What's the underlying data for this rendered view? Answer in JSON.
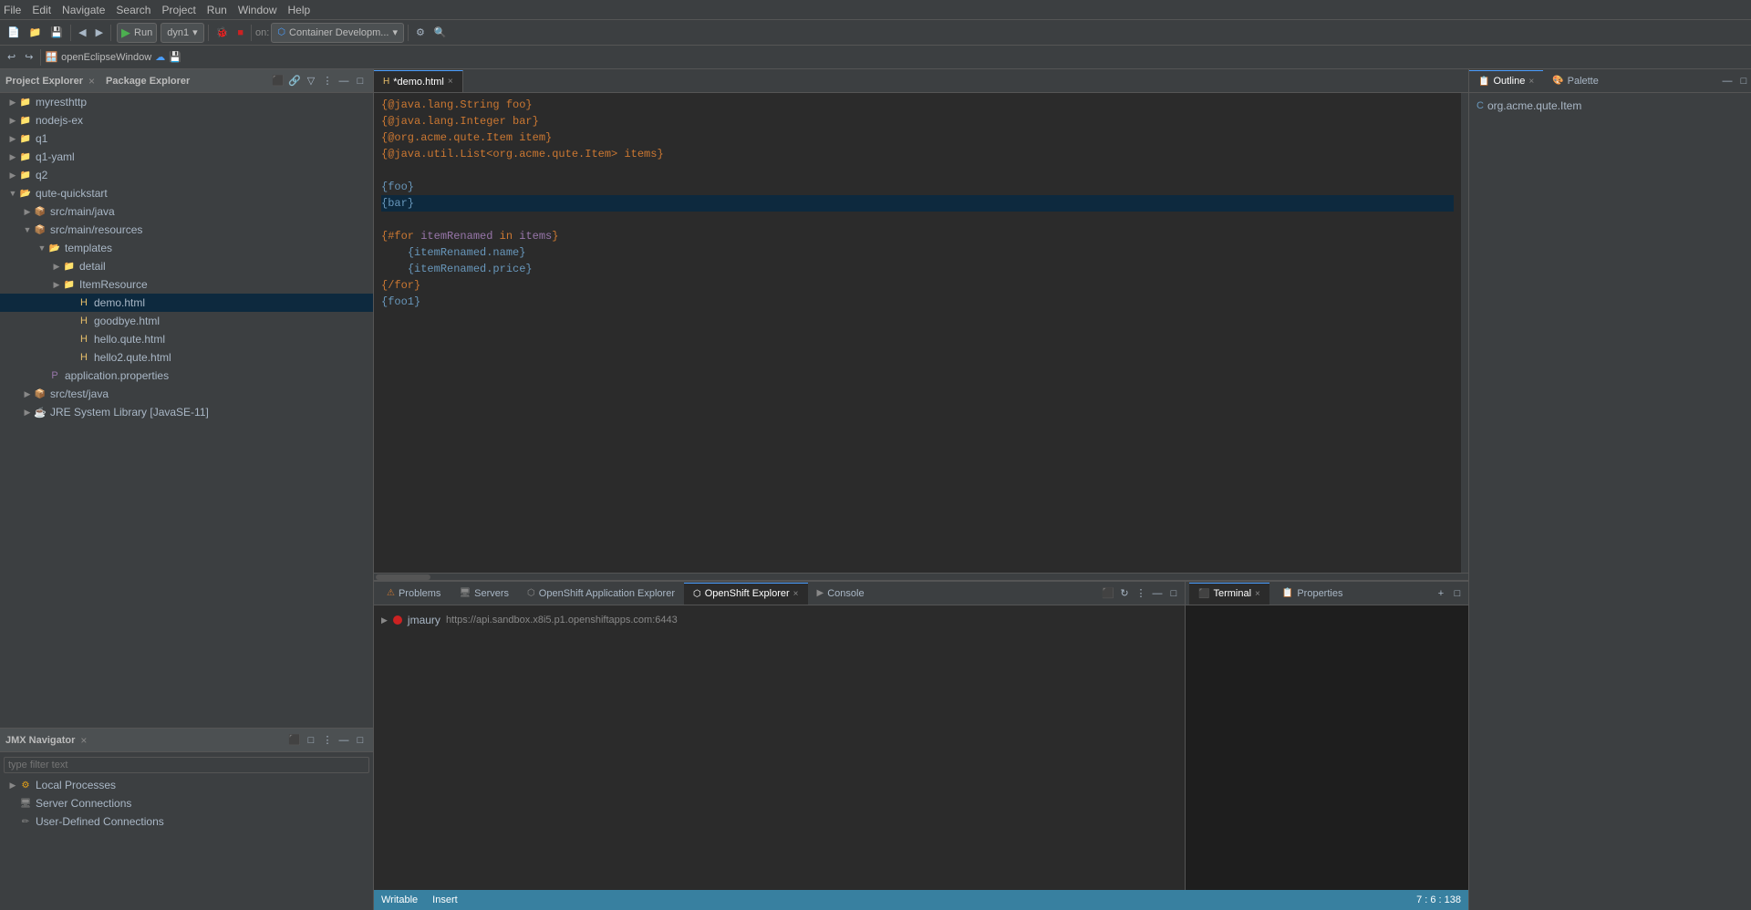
{
  "menu": {
    "items": [
      "File",
      "Edit",
      "Navigate",
      "Search",
      "Project",
      "Run",
      "Window",
      "Help"
    ]
  },
  "toolbar": {
    "run_label": "Run",
    "config_name": "dyn1",
    "container_name": "Container Developm..."
  },
  "breadcrumb": {
    "window_title": "openEclipseWindow"
  },
  "project_explorer": {
    "title": "Project Explorer",
    "package_explorer_title": "Package Explorer",
    "items": [
      {
        "label": "myresthttp",
        "type": "project",
        "level": 0,
        "expanded": false
      },
      {
        "label": "nodejs-ex",
        "type": "project",
        "level": 0,
        "expanded": false
      },
      {
        "label": "q1",
        "type": "project",
        "level": 0,
        "expanded": false
      },
      {
        "label": "q1-yaml",
        "type": "project",
        "level": 0,
        "expanded": false
      },
      {
        "label": "q2",
        "type": "project",
        "level": 0,
        "expanded": false
      },
      {
        "label": "qute-quickstart",
        "type": "project",
        "level": 0,
        "expanded": true
      },
      {
        "label": "src/main/java",
        "type": "srcfolder",
        "level": 1,
        "expanded": false
      },
      {
        "label": "src/main/resources",
        "type": "srcfolder",
        "level": 1,
        "expanded": true
      },
      {
        "label": "templates",
        "type": "folder",
        "level": 2,
        "expanded": true
      },
      {
        "label": "detail",
        "type": "folder",
        "level": 3,
        "expanded": false
      },
      {
        "label": "ItemResource",
        "type": "folder",
        "level": 3,
        "expanded": false
      },
      {
        "label": "demo.html",
        "type": "html",
        "level": 4,
        "expanded": false,
        "selected": true
      },
      {
        "label": "goodbye.html",
        "type": "html",
        "level": 4,
        "expanded": false
      },
      {
        "label": "hello.qute.html",
        "type": "html",
        "level": 4,
        "expanded": false
      },
      {
        "label": "hello2.qute.html",
        "type": "html",
        "level": 4,
        "expanded": false
      },
      {
        "label": "application.properties",
        "type": "props",
        "level": 2,
        "expanded": false
      },
      {
        "label": "src/test/java",
        "type": "srcfolder",
        "level": 1,
        "expanded": false
      },
      {
        "label": "JRE System Library [JavaSE-11]",
        "type": "lib",
        "level": 1,
        "expanded": false
      }
    ]
  },
  "jmx_navigator": {
    "title": "JMX Navigator",
    "filter_placeholder": "type filter text",
    "items": [
      {
        "label": "Local Processes",
        "type": "folder",
        "level": 0,
        "expanded": false
      },
      {
        "label": "Server Connections",
        "type": "server",
        "level": 0,
        "expanded": false
      },
      {
        "label": "User-Defined Connections",
        "type": "connection",
        "level": 0,
        "expanded": false
      }
    ]
  },
  "editor": {
    "tab_title": "*demo.html",
    "code_lines": [
      {
        "text": "{@java.lang.String foo}",
        "type": "annotation"
      },
      {
        "text": "{@java.lang.Integer bar}",
        "type": "annotation"
      },
      {
        "text": "{@org.acme.qute.Item item}",
        "type": "annotation"
      },
      {
        "text": "{@java.util.List<org.acme.qute.Item> items}",
        "type": "annotation"
      },
      {
        "text": "",
        "type": "blank"
      },
      {
        "text": "{foo}",
        "type": "expr"
      },
      {
        "text": "{bar}",
        "type": "expr",
        "highlighted": true
      },
      {
        "text": "{#for itemRenamed in items}",
        "type": "for"
      },
      {
        "text": "    {itemRenamed.name}",
        "type": "expr"
      },
      {
        "text": "    {itemRenamed.price}",
        "type": "expr"
      },
      {
        "text": "{/for}",
        "type": "for"
      },
      {
        "text": "{foo1}",
        "type": "expr"
      }
    ]
  },
  "bottom_panel": {
    "tabs": [
      {
        "label": "Problems",
        "active": false
      },
      {
        "label": "Servers",
        "active": false
      },
      {
        "label": "OpenShift Application Explorer",
        "active": false
      },
      {
        "label": "OpenShift Explorer",
        "active": true,
        "closable": true
      },
      {
        "label": "Console",
        "active": false,
        "closable": false
      }
    ],
    "openshift_row": {
      "user": "jmaury",
      "url": "https://api.sandbox.x8i5.p1.openshiftapps.com:6443"
    }
  },
  "outline": {
    "title": "Outline",
    "palette_title": "Palette",
    "item": "org.acme.qute.Item"
  },
  "terminal": {
    "title": "Terminal",
    "properties_title": "Properties"
  },
  "status_bar": {
    "writable": "Writable",
    "insert": "Insert",
    "position": "7 : 6 : 138"
  },
  "colors": {
    "accent_blue": "#4a9eff",
    "folder_yellow": "#e8a317",
    "red": "#cc2222",
    "green": "#4caf50",
    "status_bar_bg": "#3880a0"
  }
}
